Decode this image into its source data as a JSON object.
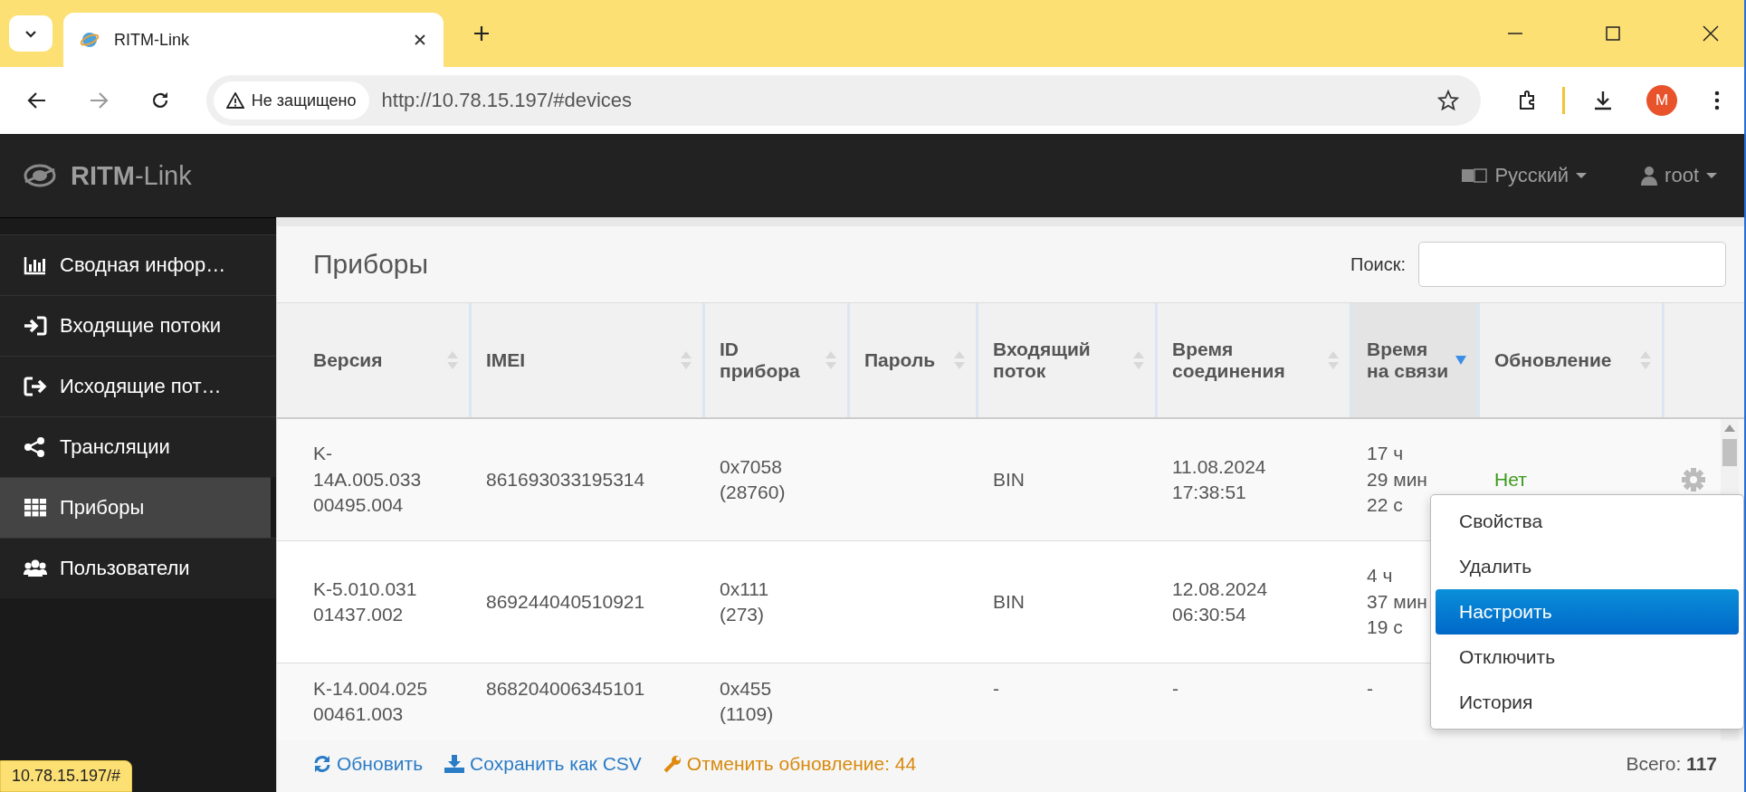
{
  "browser": {
    "tab_title": "RITM-Link",
    "security_label": "Не защищено",
    "url": "http://10.78.15.197/#devices",
    "avatar_letter": "M"
  },
  "header": {
    "brand": "**RITM**-Link",
    "language": "Русский",
    "user": "root"
  },
  "sidebar": {
    "items": [
      {
        "label": "Сводная инфор…",
        "kind": "chart",
        "selected": false
      },
      {
        "label": "Входящие потоки",
        "kind": "signin",
        "selected": false
      },
      {
        "label": "Исходящие пот…",
        "kind": "signout",
        "selected": false
      },
      {
        "label": "Трансляции",
        "kind": "share",
        "selected": false
      },
      {
        "label": "Приборы",
        "kind": "grid",
        "selected": true
      },
      {
        "label": "Пользователи",
        "kind": "users",
        "selected": false
      }
    ]
  },
  "panel": {
    "title": "Приборы",
    "search_label": "Поиск:"
  },
  "table": {
    "columns": [
      {
        "label": "Версия",
        "sorted": false
      },
      {
        "label": "IMEI",
        "sorted": false
      },
      {
        "label": "ID прибора",
        "sorted": false
      },
      {
        "label": "Пароль",
        "sorted": false
      },
      {
        "label": "Входящий поток",
        "sorted": false
      },
      {
        "label": "Время соединения",
        "sorted": false
      },
      {
        "label": "Время на связи",
        "sorted": true
      },
      {
        "label": "Обновление",
        "sorted": false
      }
    ],
    "rows": [
      {
        "cells": [
          [
            "K-",
            "14A.005.033",
            "00495.004"
          ],
          [
            "861693033195314"
          ],
          [
            "0x7058",
            "(28760)"
          ],
          [],
          [
            "BIN"
          ],
          [
            "11.08.2024",
            "17:38:51"
          ],
          [
            "17 ч",
            "29 мин",
            "22 с"
          ],
          [
            "Нет"
          ]
        ],
        "gear": true
      },
      {
        "cells": [
          [
            "K-5.010.031",
            "01437.002"
          ],
          [
            "869244040510921"
          ],
          [
            "0x111",
            "(273)"
          ],
          [],
          [
            "BIN"
          ],
          [
            "12.08.2024",
            "06:30:54"
          ],
          [
            "4 ч",
            "37 мин",
            "19 с"
          ],
          []
        ],
        "gear": false
      },
      {
        "cells": [
          [
            "K-14.004.025",
            "00461.003"
          ],
          [
            "868204006345101"
          ],
          [
            "0x455",
            "(1109)"
          ],
          [],
          [
            "-"
          ],
          [
            "-"
          ],
          [
            "-"
          ],
          []
        ],
        "gear": false
      }
    ]
  },
  "footer": {
    "actions": [
      {
        "label": "Обновить",
        "kind": "refresh"
      },
      {
        "label": "Сохранить как CSV",
        "kind": "download"
      },
      {
        "label": "Отменить обновление: 44",
        "kind": "cancel"
      }
    ],
    "total_label": "Всего:",
    "total_value": "117"
  },
  "context_menu": {
    "items": [
      {
        "label": "Свойства",
        "selected": false
      },
      {
        "label": "Удалить",
        "selected": false
      },
      {
        "label": "Настроить",
        "selected": true
      },
      {
        "label": "Отключить",
        "selected": false
      },
      {
        "label": "История",
        "selected": false
      }
    ]
  },
  "status_url": "10.78.15.197/#"
}
